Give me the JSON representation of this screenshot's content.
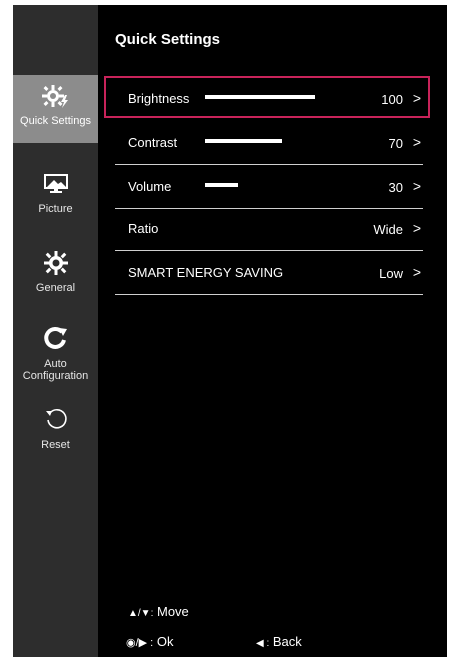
{
  "title": "Quick Settings",
  "sidebar": {
    "items": [
      {
        "label": "Quick Settings",
        "icon": "brightness-gear-icon",
        "active": true
      },
      {
        "label": "Picture",
        "icon": "picture-icon",
        "active": false
      },
      {
        "label": "General",
        "icon": "gear-icon",
        "active": false
      },
      {
        "label_lines": [
          "Auto",
          "Configuration"
        ],
        "icon": "auto-config-icon",
        "active": false
      },
      {
        "label": "Reset",
        "icon": "reset-icon",
        "active": false
      }
    ]
  },
  "settings": [
    {
      "label": "Brightness",
      "value": "100",
      "level": 100
    },
    {
      "label": "Contrast",
      "value": "70",
      "level": 70
    },
    {
      "label": "Volume",
      "value": "30",
      "level": 30
    },
    {
      "label": "Ratio",
      "value": "Wide"
    },
    {
      "label": "SMART ENERGY SAVING",
      "value": "Low"
    }
  ],
  "help": {
    "move_symbol": "▲/▼:",
    "move": "Move",
    "ok_symbol": "◉/▶ :",
    "ok": "Ok",
    "back_symbol": "◀ :",
    "back": "Back"
  },
  "colors": {
    "highlight": "#c8235a",
    "sidebar_active": "#8c8c8c",
    "sidebar": "#2d2d2d",
    "background": "#000000"
  }
}
